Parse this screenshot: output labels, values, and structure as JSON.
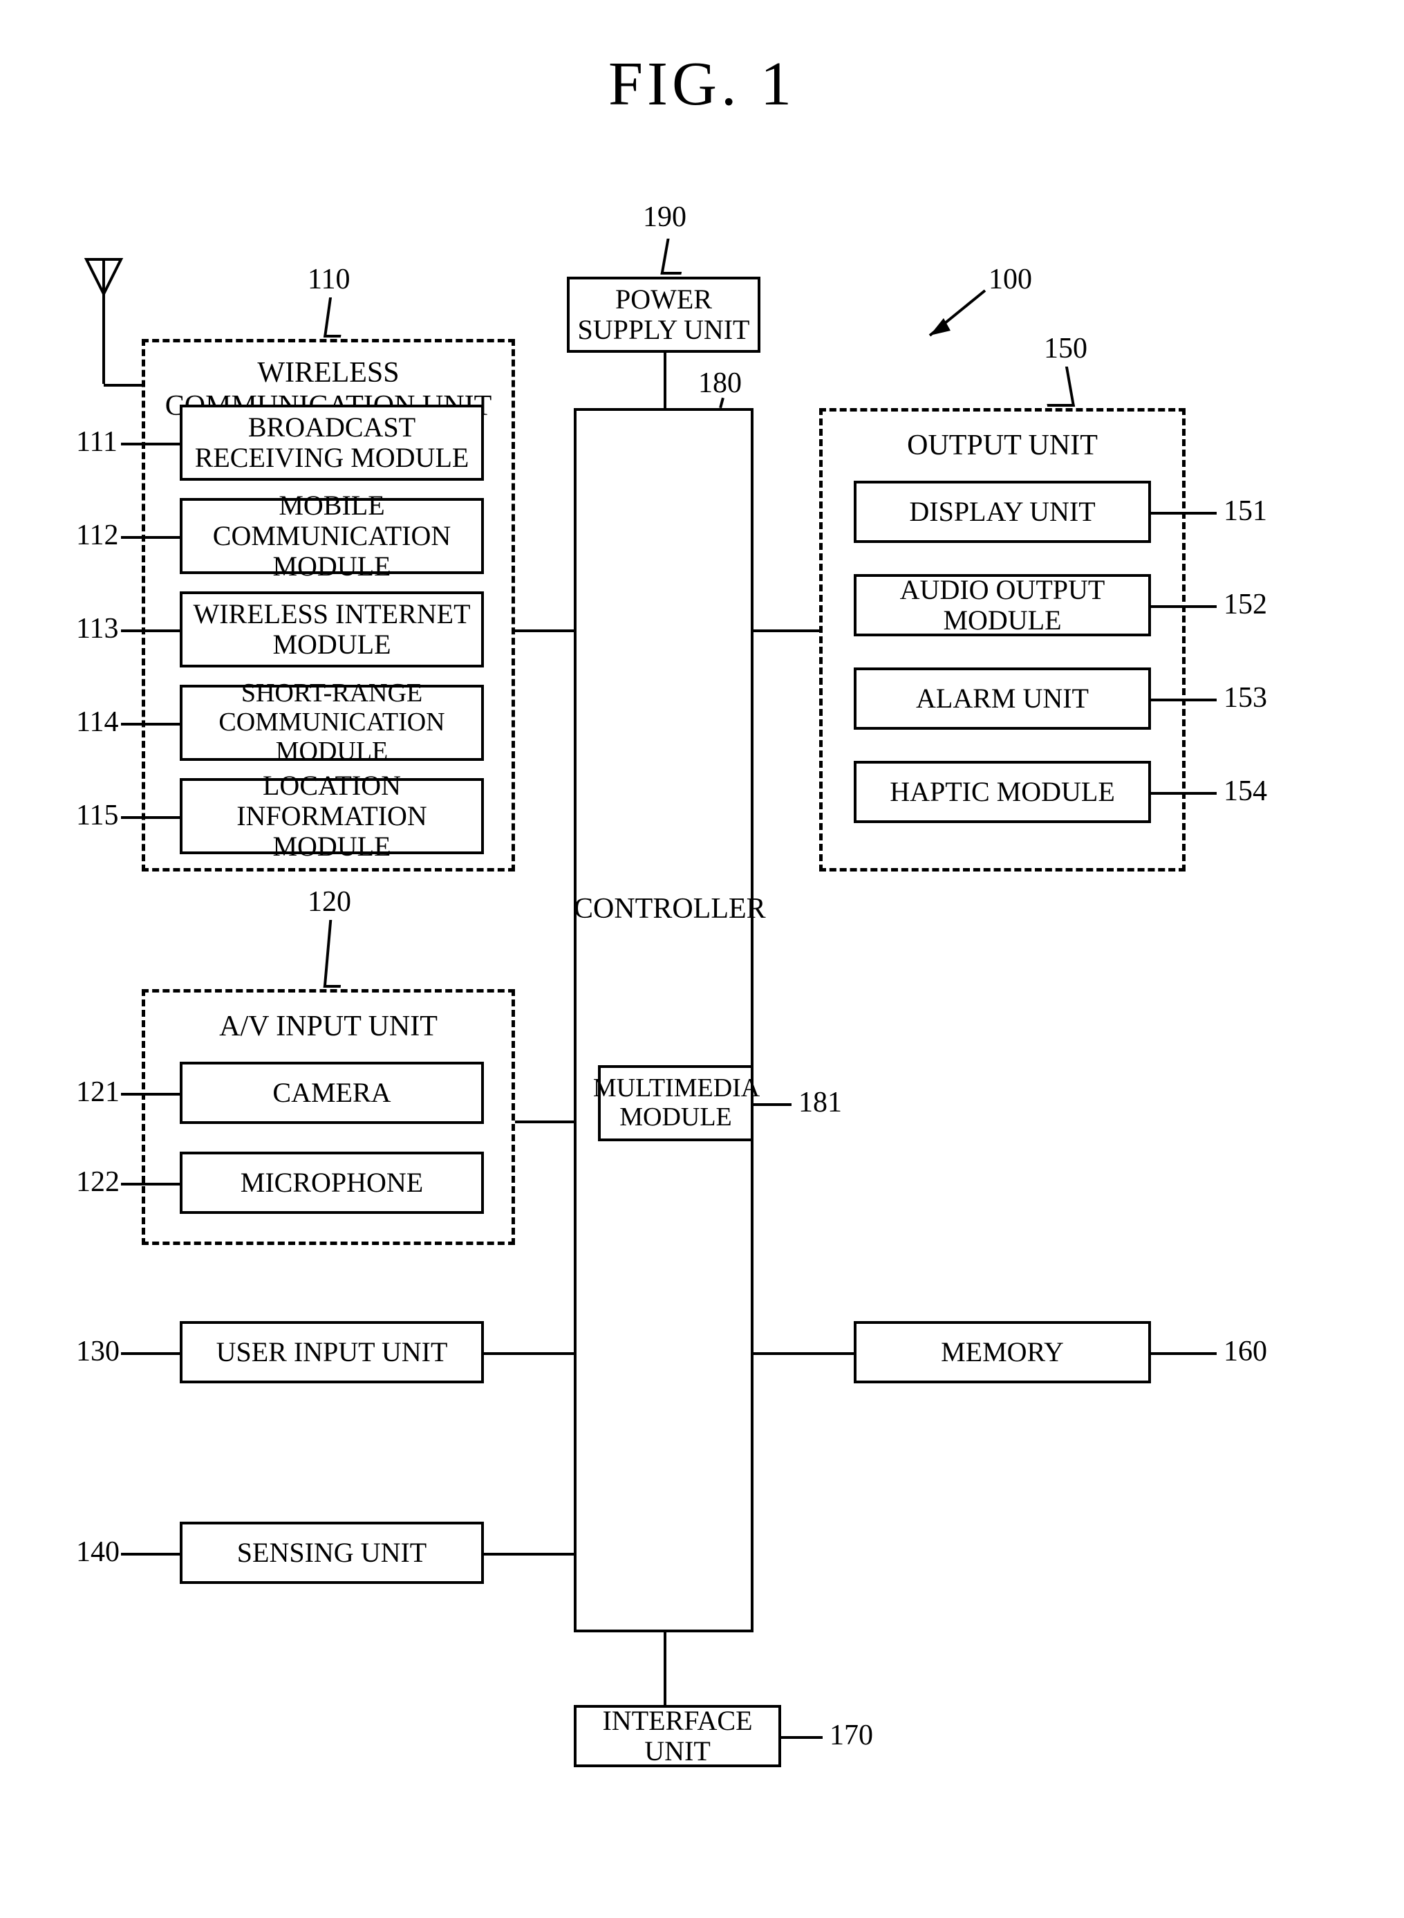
{
  "title": "FIG. 1",
  "refs": {
    "r100": "100",
    "r110": "110",
    "r111": "111",
    "r112": "112",
    "r113": "113",
    "r114": "114",
    "r115": "115",
    "r120": "120",
    "r121": "121",
    "r122": "122",
    "r130": "130",
    "r140": "140",
    "r150": "150",
    "r151": "151",
    "r152": "152",
    "r153": "153",
    "r154": "154",
    "r160": "160",
    "r170": "170",
    "r180": "180",
    "r181": "181",
    "r190": "190"
  },
  "labels": {
    "power_supply": "POWER SUPPLY UNIT",
    "wireless_unit": "WIRELESS COMMUNICATION UNIT",
    "broadcast": "BROADCAST RECEIVING MODULE",
    "mobile_comm": "MOBILE COMMUNICATION MODULE",
    "wireless_internet": "WIRELESS INTERNET MODULE",
    "short_range": "SHORT-RANGE COMMUNICATION MODULE",
    "location": "LOCATION INFORMATION MODULE",
    "av_input": "A/V INPUT UNIT",
    "camera": "CAMERA",
    "microphone": "MICROPHONE",
    "user_input": "USER INPUT UNIT",
    "sensing": "SENSING UNIT",
    "controller": "CONTROLLER",
    "multimedia": "MULTIMEDIA MODULE",
    "output_unit": "OUTPUT UNIT",
    "display": "DISPLAY UNIT",
    "audio_output": "AUDIO OUTPUT MODULE",
    "alarm": "ALARM UNIT",
    "haptic": "HAPTIC MODULE",
    "memory": "MEMORY",
    "interface": "INTERFACE UNIT"
  }
}
